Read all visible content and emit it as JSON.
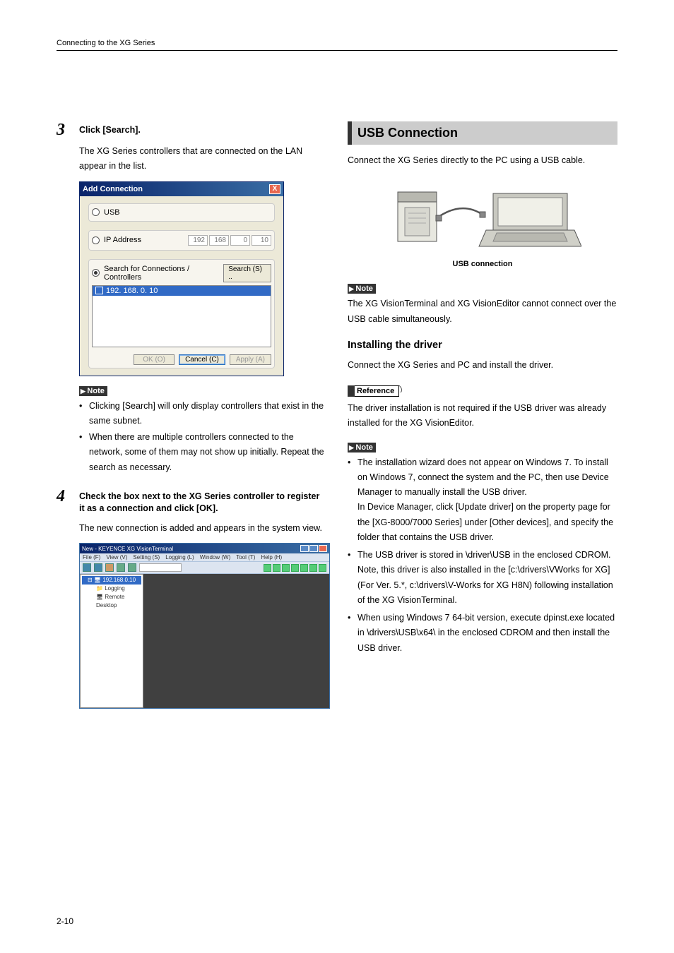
{
  "header": "Connecting to the XG Series",
  "page_number": "2-10",
  "left": {
    "step3": {
      "num": "3",
      "title": "Click [Search].",
      "body": "The XG Series controllers that are connected on the LAN appear in the list.",
      "dialog": {
        "title": "Add Connection",
        "opt_usb": "USB",
        "opt_ip": "IP Address",
        "ip": [
          "192",
          "168",
          "0",
          "10"
        ],
        "opt_search": "Search for Connections / Controllers",
        "search_btn": "Search (S) ..",
        "found": "192. 168.  0. 10",
        "ok": "OK (O)",
        "cancel": "Cancel (C)",
        "apply": "Apply (A)"
      },
      "note_label": "Note",
      "notes": [
        "Clicking [Search] will only display controllers that exist in the same subnet.",
        "When there are multiple controllers connected to the network, some of them may not show up initially. Repeat the search as necessary."
      ]
    },
    "step4": {
      "num": "4",
      "title": "Check the box next to the XG Series controller to register it as a connection and click [OK].",
      "body": "The new connection is added and appears in the system view.",
      "appwin": {
        "title": "New - KEYENCE XG VisionTerminal",
        "menu": [
          "File (F)",
          "View (V)",
          "Setting (S)",
          "Logging (L)",
          "Window (W)",
          "Tool (T)",
          "Help (H)"
        ],
        "tree_root": "192.168.0.10",
        "tree_items": [
          "Logging",
          "Remote Desktop"
        ]
      }
    }
  },
  "right": {
    "section_title": "USB Connection",
    "intro": "Connect the XG Series directly to the PC using a USB cable.",
    "fig_caption": "USB connection",
    "note1_label": "Note",
    "note1": "The XG VisionTerminal and XG VisionEditor cannot connect over the USB cable simultaneously.",
    "subhead": "Installing the driver",
    "sub_intro": "Connect the XG Series and PC and install the driver.",
    "ref_label": "Reference",
    "ref_body": "The driver installation is not required if the USB driver was already installed for the XG VisionEditor.",
    "note2_label": "Note",
    "note2_items": [
      "The installation wizard does not appear on Windows 7. To install on Windows 7, connect the system and the PC, then use Device Manager to manually install the USB driver.\nIn Device Manager, click [Update driver] on the property page for the [XG-8000/7000 Series] under [Other devices], and specify the folder that contains the USB driver.",
      "The USB driver is stored in \\driver\\USB in the enclosed CDROM. Note, this driver is also installed in the [c:\\drivers\\VWorks for XG] (For Ver. 5.*, c:\\drivers\\V-Works for XG H8N) following installation of the XG VisionTerminal.",
      "When using Windows 7 64-bit version, execute dpinst.exe located in \\drivers\\USB\\x64\\ in the enclosed CDROM and then install the USB driver."
    ]
  }
}
